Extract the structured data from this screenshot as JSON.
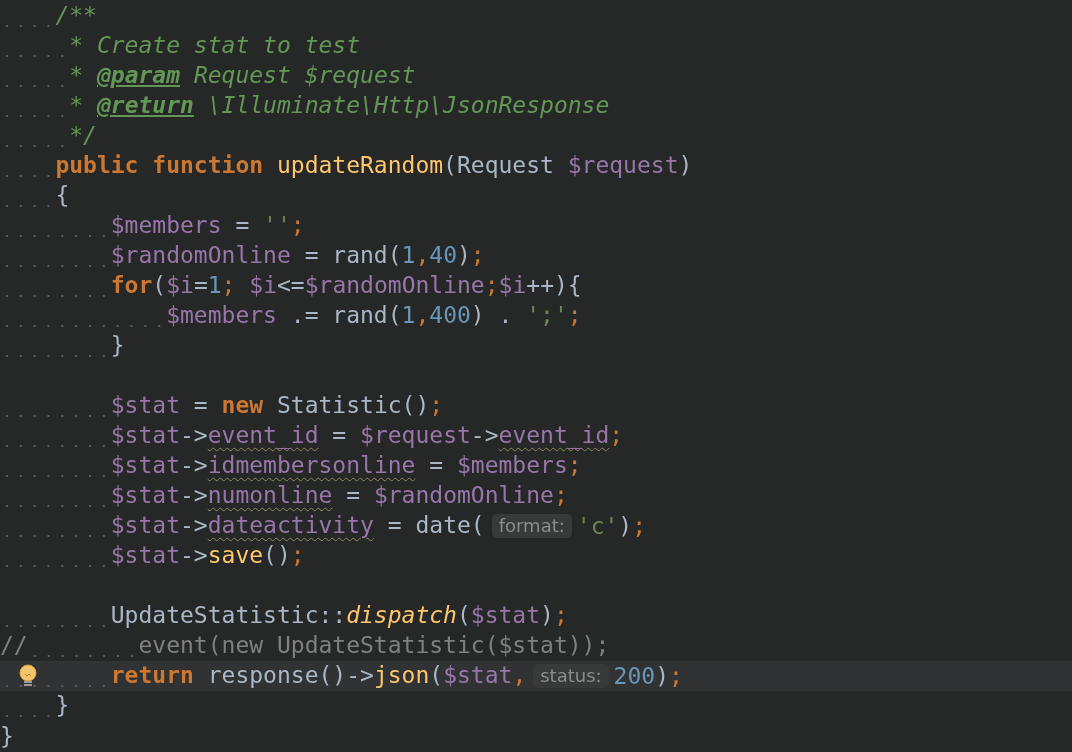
{
  "editor": {
    "lines": [
      {
        "current": false,
        "tokens": [
          {
            "kind": "indent-1"
          },
          {
            "text": "/**",
            "kind": "comment"
          }
        ]
      },
      {
        "current": false,
        "tokens": [
          {
            "kind": "doc-indent"
          },
          {
            "text": "* Create stat to test",
            "kind": "comment"
          }
        ]
      },
      {
        "current": false,
        "tokens": [
          {
            "kind": "doc-indent"
          },
          {
            "text": "* ",
            "kind": "comment"
          },
          {
            "text": "@param",
            "kind": "doctag"
          },
          {
            "text": " Request $request",
            "kind": "comment"
          }
        ]
      },
      {
        "current": false,
        "tokens": [
          {
            "kind": "doc-indent"
          },
          {
            "text": "* ",
            "kind": "comment"
          },
          {
            "text": "@return",
            "kind": "doctag"
          },
          {
            "text": " \\Illuminate\\Http\\JsonResponse",
            "kind": "comment"
          }
        ]
      },
      {
        "current": false,
        "tokens": [
          {
            "kind": "doc-indent"
          },
          {
            "text": "*/",
            "kind": "comment"
          }
        ]
      },
      {
        "current": false,
        "tokens": [
          {
            "kind": "indent-1"
          },
          {
            "text": "public function ",
            "kind": "keyword"
          },
          {
            "text": "updateRandom",
            "kind": "function"
          },
          {
            "text": "(Request ",
            "kind": "plain"
          },
          {
            "text": "$request",
            "kind": "variable"
          },
          {
            "text": ")",
            "kind": "plain"
          }
        ]
      },
      {
        "current": false,
        "tokens": [
          {
            "kind": "indent-1"
          },
          {
            "text": "{",
            "kind": "plain"
          }
        ]
      },
      {
        "current": false,
        "tokens": [
          {
            "kind": "indent-2"
          },
          {
            "text": "$members",
            "kind": "variable"
          },
          {
            "text": " = ",
            "kind": "plain"
          },
          {
            "text": "''",
            "kind": "string"
          },
          {
            "text": ";",
            "kind": "punct"
          }
        ]
      },
      {
        "current": false,
        "tokens": [
          {
            "kind": "indent-2"
          },
          {
            "text": "$randomOnline",
            "kind": "variable"
          },
          {
            "text": " = rand(",
            "kind": "plain"
          },
          {
            "text": "1",
            "kind": "number"
          },
          {
            "text": ",",
            "kind": "punct"
          },
          {
            "text": "40",
            "kind": "number"
          },
          {
            "text": ")",
            "kind": "plain"
          },
          {
            "text": ";",
            "kind": "punct"
          }
        ]
      },
      {
        "current": false,
        "tokens": [
          {
            "kind": "indent-2"
          },
          {
            "text": "for",
            "kind": "keyword"
          },
          {
            "text": "(",
            "kind": "plain"
          },
          {
            "text": "$i",
            "kind": "variable"
          },
          {
            "text": "=",
            "kind": "plain"
          },
          {
            "text": "1",
            "kind": "number"
          },
          {
            "text": "; ",
            "kind": "punct"
          },
          {
            "text": "$i",
            "kind": "variable"
          },
          {
            "text": "<=",
            "kind": "plain"
          },
          {
            "text": "$randomOnline",
            "kind": "variable"
          },
          {
            "text": ";",
            "kind": "punct"
          },
          {
            "text": "$i",
            "kind": "variable"
          },
          {
            "text": "++){",
            "kind": "plain"
          }
        ]
      },
      {
        "current": false,
        "tokens": [
          {
            "kind": "indent-3"
          },
          {
            "text": "$members",
            "kind": "variable"
          },
          {
            "text": " .= rand(",
            "kind": "plain"
          },
          {
            "text": "1",
            "kind": "number"
          },
          {
            "text": ",",
            "kind": "punct"
          },
          {
            "text": "400",
            "kind": "number"
          },
          {
            "text": ") . ",
            "kind": "plain"
          },
          {
            "text": "';'",
            "kind": "string"
          },
          {
            "text": ";",
            "kind": "punct"
          }
        ]
      },
      {
        "current": false,
        "tokens": [
          {
            "kind": "indent-2"
          },
          {
            "text": "}",
            "kind": "plain"
          }
        ]
      },
      {
        "current": false
      },
      {
        "current": false,
        "tokens": [
          {
            "kind": "indent-2"
          },
          {
            "text": "$stat",
            "kind": "variable"
          },
          {
            "text": " = ",
            "kind": "plain"
          },
          {
            "text": "new",
            "kind": "keyword"
          },
          {
            "text": " Statistic()",
            "kind": "plain"
          },
          {
            "text": ";",
            "kind": "punct"
          }
        ]
      },
      {
        "current": false,
        "tokens": [
          {
            "kind": "indent-2"
          },
          {
            "text": "$stat",
            "kind": "variable"
          },
          {
            "text": "->",
            "kind": "plain"
          },
          {
            "text": "event_id",
            "kind": "field"
          },
          {
            "text": " = ",
            "kind": "plain"
          },
          {
            "text": "$request",
            "kind": "variable"
          },
          {
            "text": "->",
            "kind": "plain"
          },
          {
            "text": "event_id",
            "kind": "field"
          },
          {
            "text": ";",
            "kind": "punct"
          }
        ]
      },
      {
        "current": false,
        "tokens": [
          {
            "kind": "indent-2"
          },
          {
            "text": "$stat",
            "kind": "variable"
          },
          {
            "text": "->",
            "kind": "plain"
          },
          {
            "text": "idmembersonline",
            "kind": "field"
          },
          {
            "text": " = ",
            "kind": "plain"
          },
          {
            "text": "$members",
            "kind": "variable"
          },
          {
            "text": ";",
            "kind": "punct"
          }
        ]
      },
      {
        "current": false,
        "tokens": [
          {
            "kind": "indent-2"
          },
          {
            "text": "$stat",
            "kind": "variable"
          },
          {
            "text": "->",
            "kind": "plain"
          },
          {
            "text": "numonline",
            "kind": "field"
          },
          {
            "text": " = ",
            "kind": "plain"
          },
          {
            "text": "$randomOnline",
            "kind": "variable"
          },
          {
            "text": ";",
            "kind": "punct"
          }
        ]
      },
      {
        "current": false,
        "tokens": [
          {
            "kind": "indent-2"
          },
          {
            "text": "$stat",
            "kind": "variable"
          },
          {
            "text": "->",
            "kind": "plain"
          },
          {
            "text": "dateactivity",
            "kind": "field"
          },
          {
            "text": " = date(",
            "kind": "plain"
          },
          {
            "text": "format:",
            "kind": "hint"
          },
          {
            "text": "'c'",
            "kind": "string"
          },
          {
            "text": ")",
            "kind": "plain"
          },
          {
            "text": ";",
            "kind": "punct"
          }
        ]
      },
      {
        "current": false,
        "tokens": [
          {
            "kind": "indent-2"
          },
          {
            "text": "$stat",
            "kind": "variable"
          },
          {
            "text": "->",
            "kind": "plain"
          },
          {
            "text": "save",
            "kind": "function"
          },
          {
            "text": "()",
            "kind": "plain"
          },
          {
            "text": ";",
            "kind": "punct"
          }
        ]
      },
      {
        "current": false
      },
      {
        "current": false,
        "tokens": [
          {
            "kind": "indent-2"
          },
          {
            "text": "UpdateStatistic::",
            "kind": "plain"
          },
          {
            "text": "dispatch",
            "kind": "static"
          },
          {
            "text": "(",
            "kind": "plain"
          },
          {
            "text": "$stat",
            "kind": "variable"
          },
          {
            "text": ")",
            "kind": "plain"
          },
          {
            "text": ";",
            "kind": "punct"
          }
        ]
      },
      {
        "current": false,
        "tokens": [
          {
            "text": "//",
            "kind": "disabled"
          },
          {
            "kind": "indent-2"
          },
          {
            "text": "event(new UpdateStatistic($stat));",
            "kind": "disabled"
          }
        ]
      },
      {
        "current": true,
        "tokens": [
          {
            "kind": "indent-2"
          },
          {
            "text": "return",
            "kind": "keyword"
          },
          {
            "text": " response()->",
            "kind": "plain"
          },
          {
            "text": "json",
            "kind": "function"
          },
          {
            "text": "(",
            "kind": "plain"
          },
          {
            "text": "$stat",
            "kind": "variable"
          },
          {
            "text": ",",
            "kind": "punct"
          },
          {
            "text": "status:",
            "kind": "hint"
          },
          {
            "text": "200",
            "kind": "number"
          },
          {
            "text": ")",
            "kind": "plain"
          },
          {
            "text": ";",
            "kind": "punct"
          }
        ]
      },
      {
        "current": false,
        "tokens": [
          {
            "kind": "indent-1"
          },
          {
            "text": "}",
            "kind": "plain"
          }
        ]
      },
      {
        "current": false,
        "tokens": [
          {
            "text": "}",
            "kind": "plain"
          }
        ]
      }
    ]
  }
}
